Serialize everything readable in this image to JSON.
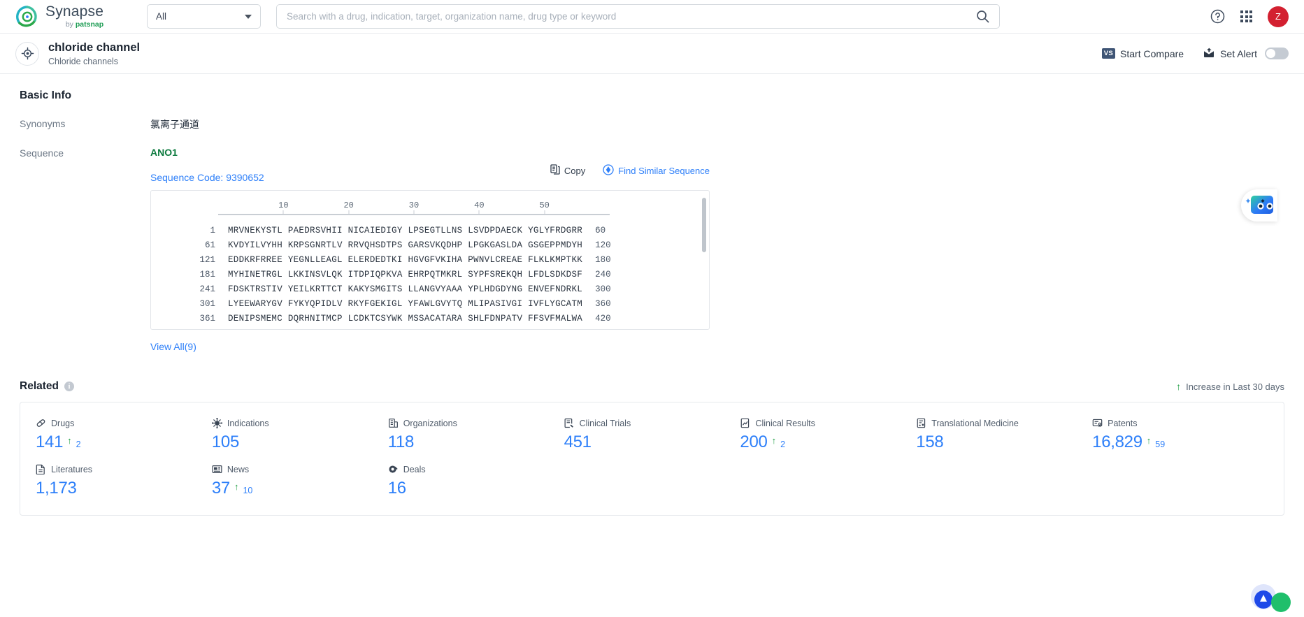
{
  "header": {
    "logo_name": "Synapse",
    "logo_by": "by ",
    "logo_brand": "patsnap",
    "category_value": "All",
    "search_placeholder": "Search with a drug, indication, target, organization name, drug type or keyword",
    "avatar_initial": "Z"
  },
  "entity": {
    "title": "chloride channel",
    "subtitle": "Chloride channels",
    "compare_badge": "VS",
    "compare_label": "Start Compare",
    "alert_label": "Set Alert"
  },
  "basic_info": {
    "section_title": "Basic Info",
    "synonyms_label": "Synonyms",
    "synonyms_value": "氯离子通道",
    "sequence_label": "Sequence",
    "gene_name": "ANO1",
    "sequence_code": "Sequence Code: 9390652",
    "copy_label": "Copy",
    "find_similar_label": "Find Similar Sequence",
    "view_all_label": "View All(9)",
    "ruler_ticks": [
      "10",
      "20",
      "30",
      "40",
      "50"
    ],
    "sequence_rows": [
      {
        "start": "1",
        "chunks": "MRVNEKYSTL PAEDRSVHII NICAIEDIGY LPSEGTLLNS LSVDPDAECK YGLYFRDGRR",
        "end": "60"
      },
      {
        "start": "61",
        "chunks": "KVDYILVYHH KRPSGNRTLV RRVQHSDTPS GARSVKQDHP LPGKGASLDA GSGEPPMDYH",
        "end": "120"
      },
      {
        "start": "121",
        "chunks": "EDDKRFRREE YEGNLLEAGL ELERDEDTKI HGVGFVKIHA PWNVLCREAE FLKLKMPTKK",
        "end": "180"
      },
      {
        "start": "181",
        "chunks": "MYHINETRGL LKKINSVLQK ITDPIQPKVA EHRPQTMKRL SYPFSREKQH LFDLSDKDSF",
        "end": "240"
      },
      {
        "start": "241",
        "chunks": "FDSKTRSTIV YEILKRTTCT KAKYSMGITS LLANGVYAAA YPLHDGDYNG ENVEFNDRKL",
        "end": "300"
      },
      {
        "start": "301",
        "chunks": "LYEEWARYGV FYKYQPIDLV RKYFGEKIGL YFAWLGVYTQ MLIPASIVGI IVFLYGCATM",
        "end": "360"
      },
      {
        "start": "361",
        "chunks": "DENIPSMEMC DQRHNITMCP LCDKTCSYWK MSSACATARA SHLFDNPATV FFSVFMALWA",
        "end": "420"
      }
    ]
  },
  "related": {
    "section_title": "Related",
    "info_icon_char": "i",
    "legend_label": "Increase in Last 30 days",
    "stats": [
      {
        "icon": "capsule-icon",
        "label": "Drugs",
        "value": "141",
        "delta": "2"
      },
      {
        "icon": "virus-icon",
        "label": "Indications",
        "value": "105",
        "delta": ""
      },
      {
        "icon": "building-icon",
        "label": "Organizations",
        "value": "118",
        "delta": ""
      },
      {
        "icon": "clinical-trial-icon",
        "label": "Clinical Trials",
        "value": "451",
        "delta": ""
      },
      {
        "icon": "clinical-result-icon",
        "label": "Clinical Results",
        "value": "200",
        "delta": "2"
      },
      {
        "icon": "translational-medicine-icon",
        "label": "Translational Medicine",
        "value": "158",
        "delta": ""
      },
      {
        "icon": "patent-icon",
        "label": "Patents",
        "value": "16,829",
        "delta": "59"
      },
      {
        "icon": "literature-icon",
        "label": "Literatures",
        "value": "1,173",
        "delta": ""
      },
      {
        "icon": "news-icon",
        "label": "News",
        "value": "37",
        "delta": "10"
      },
      {
        "icon": "deal-icon",
        "label": "Deals",
        "value": "16",
        "delta": ""
      }
    ]
  },
  "colors": {
    "accent_blue": "#2d7ff9",
    "green": "#24a148",
    "gene_green": "#0c7a3e",
    "avatar_red": "#d32030"
  }
}
